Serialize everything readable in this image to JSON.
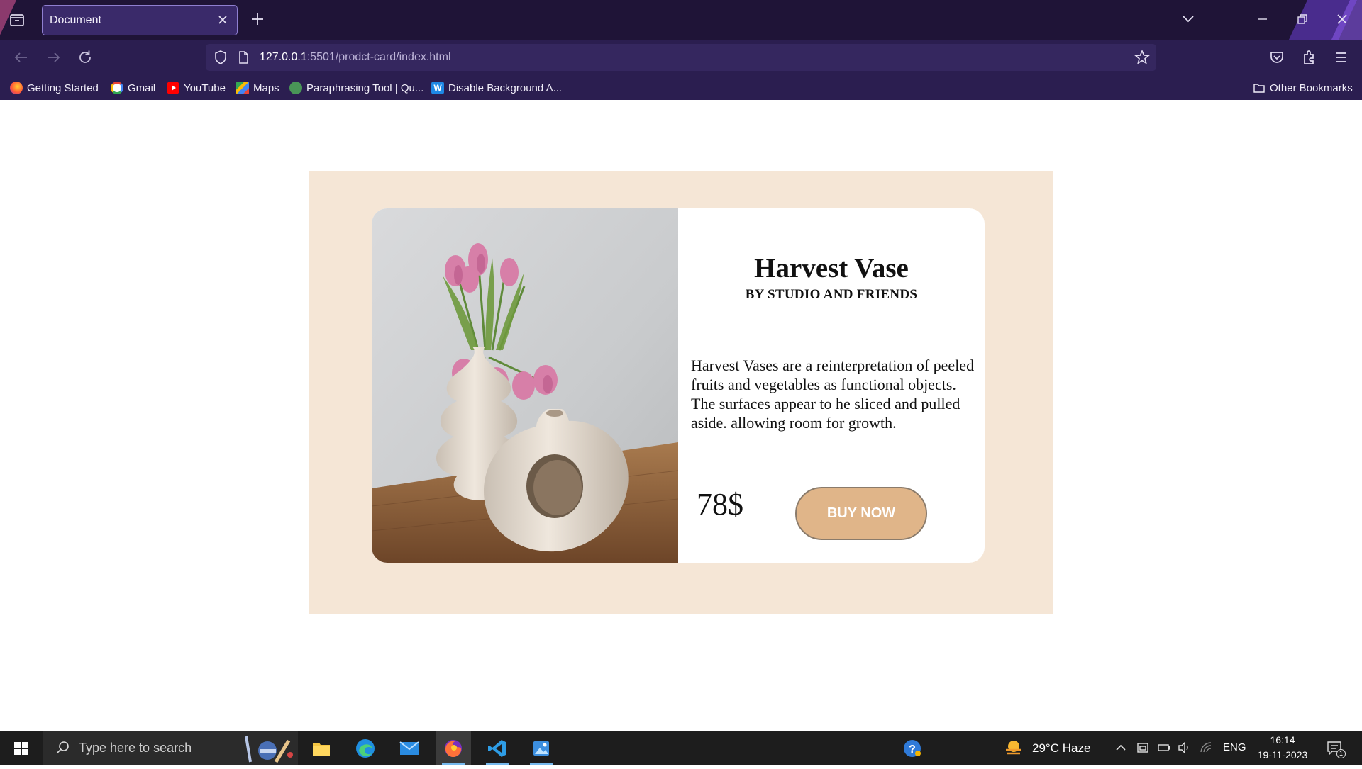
{
  "browser": {
    "tab_title": "Document",
    "url_host": "127.0.0.1",
    "url_path": ":5501/prodct-card/index.html",
    "bookmarks": [
      {
        "label": "Getting Started",
        "icon": "firefox-icon",
        "color": "#ff7139"
      },
      {
        "label": "Gmail",
        "icon": "google-icon",
        "color": "#ea4335"
      },
      {
        "label": "YouTube",
        "icon": "youtube-icon",
        "color": "#ff0000"
      },
      {
        "label": "Maps",
        "icon": "maps-icon",
        "color": "#34a853"
      },
      {
        "label": "Paraphrasing Tool | Qu...",
        "icon": "quillbot-icon",
        "color": "#499557"
      },
      {
        "label": "Disable Background A...",
        "icon": "w-icon",
        "color": "#1e88e5"
      }
    ],
    "other_bookmarks": "Other Bookmarks"
  },
  "product": {
    "title": "Harvest Vase",
    "brand": "BY STUDIO AND FRIENDS",
    "description": "Harvest Vases are a reinterpretation of peeled fruits and vegetables as functional objects. The surfaces appear to he sliced and pulled aside. allowing room for growth.",
    "price": "78$",
    "buy_label": "BUY NOW",
    "image_icon": "vase-photo",
    "colors": {
      "stage": "#f5e6d6",
      "button": "#e0b589"
    }
  },
  "taskbar": {
    "search_placeholder": "Type here to search",
    "weather": "29°C  Haze",
    "language": "ENG",
    "time": "16:14",
    "date": "19-11-2023",
    "notification_count": "1"
  }
}
